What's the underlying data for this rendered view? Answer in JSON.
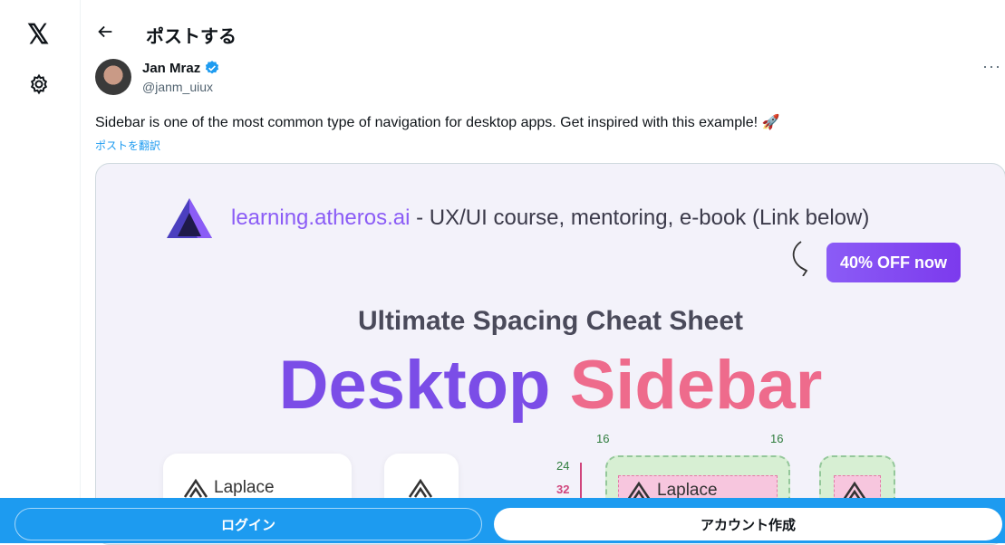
{
  "nav": {
    "logo_icon": "x-logo-icon",
    "logo_glyph": "𝕏",
    "settings_icon": "gear-icon"
  },
  "header": {
    "back_icon": "arrow-left-icon",
    "title": "ポストする"
  },
  "post": {
    "author_name": "Jan Mraz",
    "handle": "@janm_uiux",
    "more_glyph": "···",
    "text": "Sidebar is one of the most common type of navigation for desktop apps. Get inspired with this example! 🚀",
    "translate": "ポストを翻訳"
  },
  "media": {
    "site": "learning.atheros.ai",
    "course_rest": " - UX/UI course, mentoring, e-book (Link below)",
    "promo": "40% OFF now",
    "subtitle": "Ultimate Spacing Cheat Sheet",
    "headline_part1": "Desktop",
    "headline_part2": "Sidebar",
    "brand": "Laplace",
    "dims": {
      "left": "16",
      "right": "16",
      "top": "24",
      "inner": "32"
    }
  },
  "bottom_bar": {
    "login": "ログイン",
    "signup": "アカウント作成"
  },
  "colors": {
    "accent": "#1d9bf0",
    "purple": "#8b5cf6"
  }
}
